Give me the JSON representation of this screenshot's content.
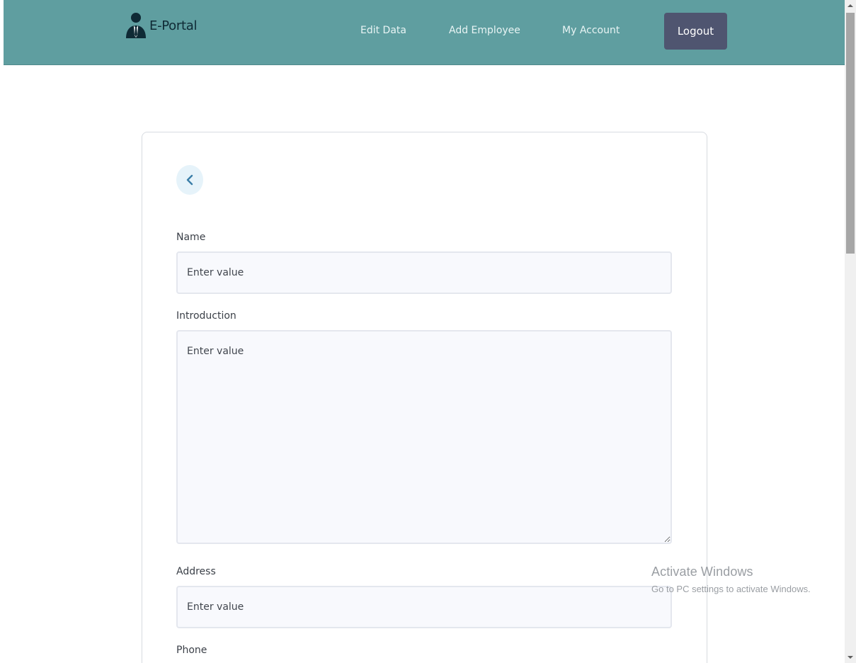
{
  "header": {
    "brand_name": "E-Portal",
    "brand_icon": "businessman-icon",
    "nav": {
      "edit_data": "Edit Data",
      "add_employee": "Add Employee",
      "my_account": "My Account"
    },
    "logout_label": "Logout"
  },
  "form": {
    "back_icon": "chevron-left-icon",
    "fields": {
      "name": {
        "label": "Name",
        "placeholder": "Enter value"
      },
      "introduction": {
        "label": "Introduction",
        "placeholder": "Enter value"
      },
      "address": {
        "label": "Address",
        "placeholder": "Enter value"
      },
      "phone": {
        "label": "Phone"
      }
    }
  },
  "watermark": {
    "title": "Activate Windows",
    "subtitle": "Go to PC settings to activate Windows."
  },
  "colors": {
    "navbar_bg": "#5f9ea0",
    "logout_bg": "#4f5570",
    "input_bg": "#f8f9fd",
    "back_button_bg": "#e6f3fa"
  }
}
